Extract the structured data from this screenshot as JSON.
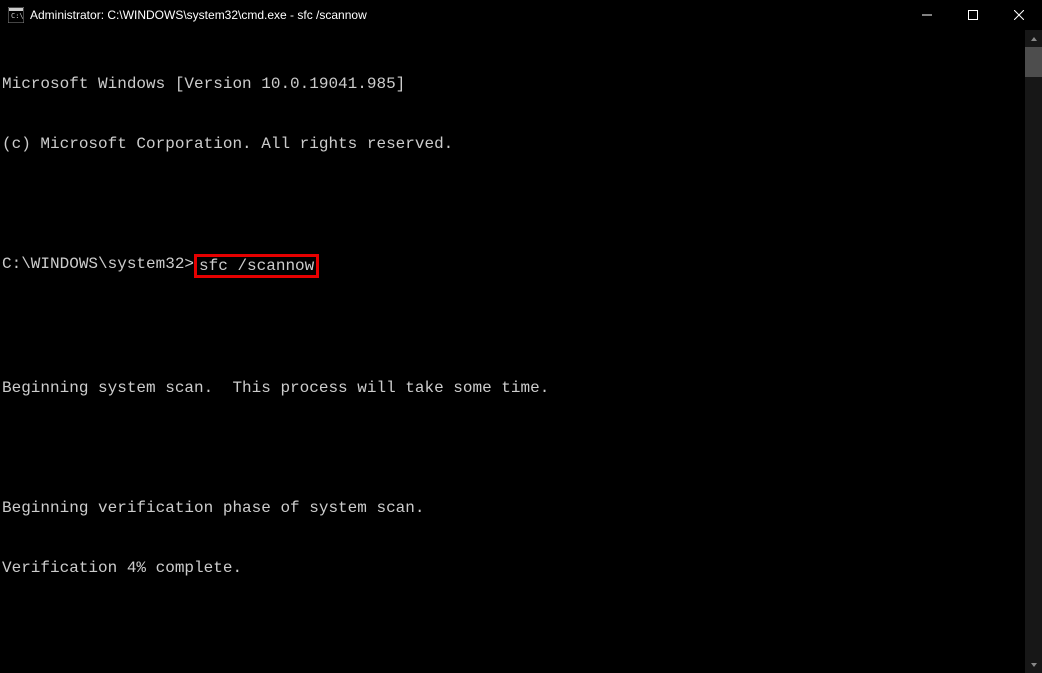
{
  "titlebar": {
    "title": "Administrator: C:\\WINDOWS\\system32\\cmd.exe - sfc  /scannow"
  },
  "terminal": {
    "line1": "Microsoft Windows [Version 10.0.19041.985]",
    "line2": "(c) Microsoft Corporation. All rights reserved.",
    "prompt": "C:\\WINDOWS\\system32>",
    "command": "sfc /scannow",
    "line3": "Beginning system scan.  This process will take some time.",
    "line4": "Beginning verification phase of system scan.",
    "line5": "Verification 4% complete."
  }
}
